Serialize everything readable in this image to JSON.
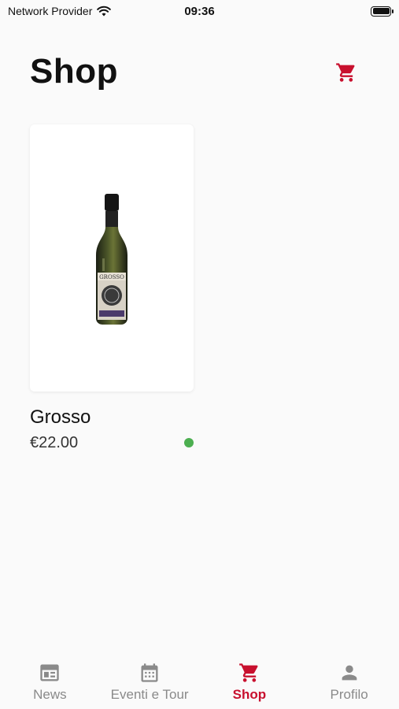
{
  "status_bar": {
    "carrier": "Network Provider",
    "time": "09:36"
  },
  "header": {
    "title": "Shop",
    "cart_icon": "cart-icon"
  },
  "products": [
    {
      "name": "Grosso",
      "price": "€22.00",
      "available": true,
      "availability_color": "#4caf50"
    }
  ],
  "colors": {
    "accent": "#c8102e",
    "inactive": "#8a8a8a",
    "available": "#4caf50"
  },
  "bottom_nav": {
    "items": [
      {
        "label": "News",
        "icon": "newspaper-icon",
        "active": false
      },
      {
        "label": "Eventi e Tour",
        "icon": "calendar-icon",
        "active": false
      },
      {
        "label": "Shop",
        "icon": "cart-icon",
        "active": true
      },
      {
        "label": "Profilo",
        "icon": "person-icon",
        "active": false
      }
    ]
  }
}
